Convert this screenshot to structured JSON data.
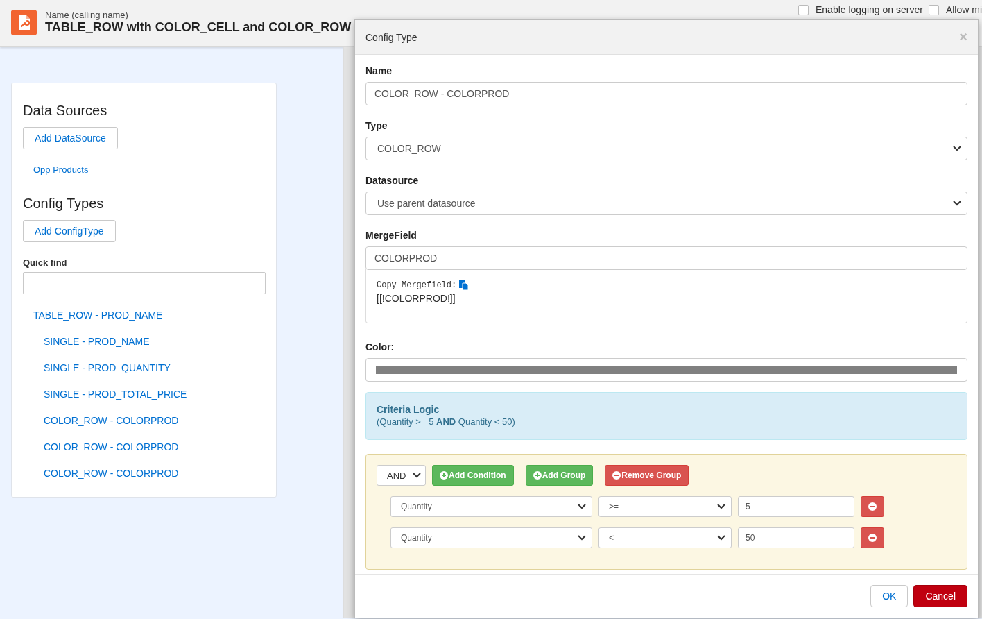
{
  "header": {
    "caption": "Name (calling name)",
    "title": "TABLE_ROW with COLOR_CELL and COLOR_ROW",
    "options": [
      {
        "label": "Enable logging on server",
        "checked": false
      },
      {
        "label": "Allow mi",
        "checked": false
      }
    ]
  },
  "sidebar": {
    "data_sources_heading": "Data Sources",
    "add_datasource": "Add DataSource",
    "data_sources": [
      "Opp Products"
    ],
    "config_types_heading": "Config Types",
    "add_configtype": "Add ConfigType",
    "quick_find_label": "Quick find",
    "config_types": [
      {
        "label": "TABLE_ROW - PROD_NAME",
        "children": [
          {
            "label": "SINGLE - PROD_NAME"
          },
          {
            "label": "SINGLE - PROD_QUANTITY"
          },
          {
            "label": "SINGLE - PROD_TOTAL_PRICE"
          },
          {
            "label": "COLOR_ROW - COLORPROD"
          },
          {
            "label": "COLOR_ROW - COLORPROD"
          },
          {
            "label": "COLOR_ROW - COLORPROD"
          }
        ]
      }
    ]
  },
  "dialog": {
    "title": "Config Type",
    "close": "×",
    "name_label": "Name",
    "name_value": "COLOR_ROW - COLORPROD",
    "type_label": "Type",
    "type_value": "COLOR_ROW",
    "datasource_label": "Datasource",
    "datasource_value": "Use parent datasource",
    "mergefield_label": "MergeField",
    "mergefield_value": "COLORPROD",
    "copy_label": "Copy Mergefield:",
    "mergefield_code": "[[!COLORPROD!]]",
    "color_label": "Color:",
    "color": "#808080",
    "criteria_title": "Criteria Logic",
    "criteria_text": "(Quantity >= 5 **AND** Quantity < 50)",
    "group": {
      "operator": "AND",
      "add_condition": "Add Condition",
      "add_group": "Add Group",
      "remove_group": "Remove Group",
      "conditions": [
        {
          "field": "Quantity",
          "operator": ">=",
          "value": "5"
        },
        {
          "field": "Quantity",
          "operator": "<",
          "value": "50"
        }
      ]
    },
    "ok": "OK",
    "cancel": "Cancel"
  }
}
